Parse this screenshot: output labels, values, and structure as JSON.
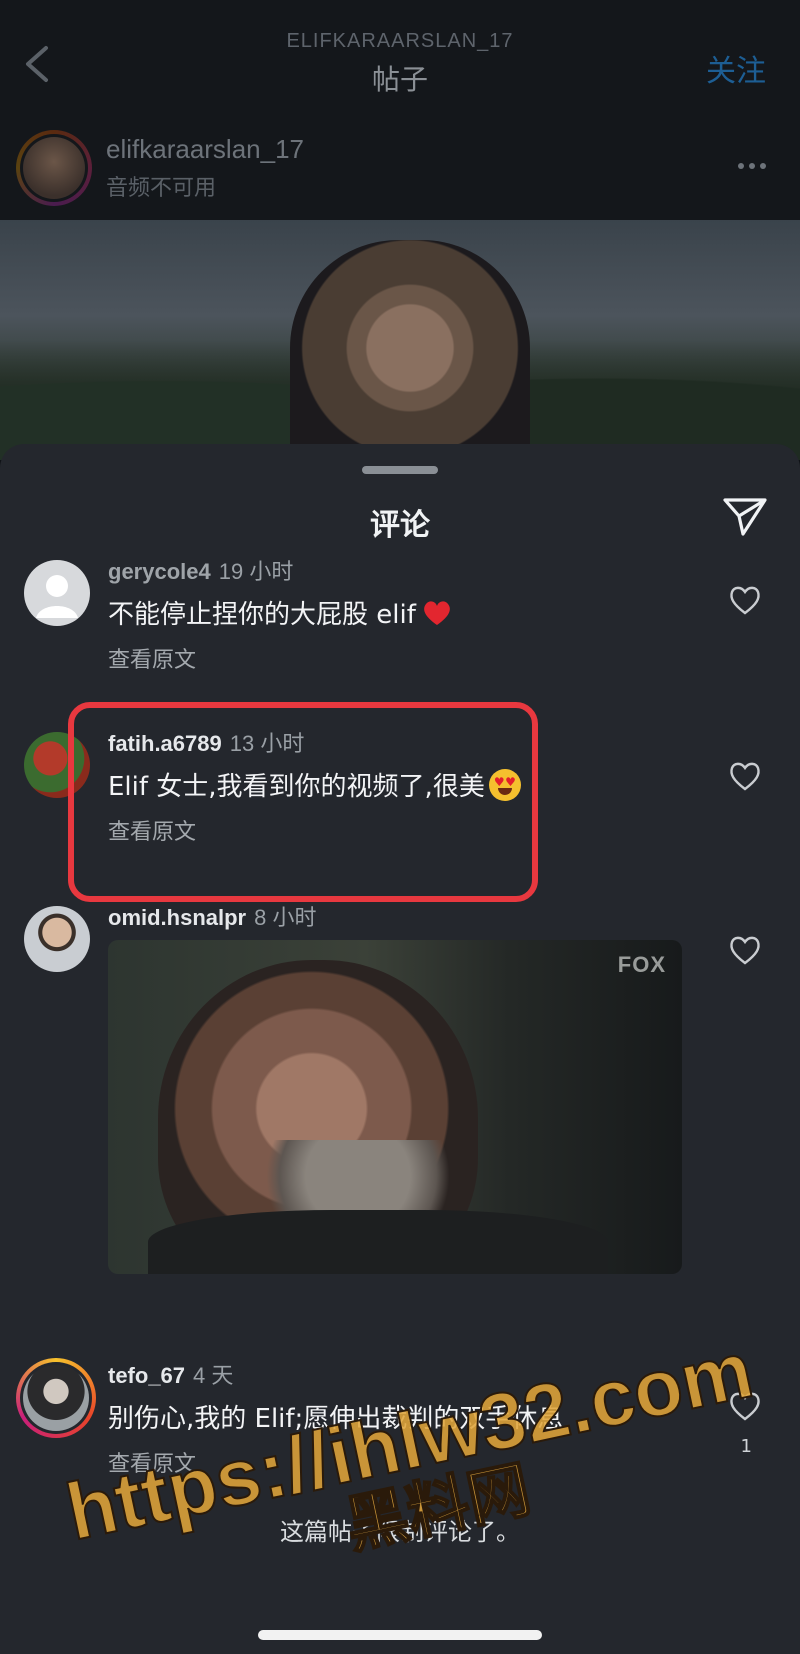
{
  "header": {
    "username": "ELIFKARAARSLAN_17",
    "title": "帖子",
    "follow_label": "关注"
  },
  "post": {
    "author": "elifkaraarslan_17",
    "subtitle": "音频不可用"
  },
  "sheet": {
    "title": "评论",
    "restricted_notice": "这篇帖子限制评论了。"
  },
  "comments": [
    {
      "username": "gerycole4",
      "time": "19 小时",
      "text": "不能停止捏你的大屁股 elif",
      "emoji": "red-heart",
      "translate_label": "查看原文"
    },
    {
      "username": "fatih.a6789",
      "time": "13 小时",
      "text": "Elif 女士,我看到你的视频了,很美",
      "emoji": "heart-eyes-face",
      "translate_label": "查看原文",
      "highlighted": true
    },
    {
      "username": "omid.hsnalpr",
      "time": "8 小时",
      "media": "gif",
      "media_logo": "FOX"
    },
    {
      "username": "tefo_67",
      "time": "4 天",
      "text": "别伤心,我的 Elif;愿伸出裁判的双手休息",
      "translate_label": "查看原文",
      "likes": "1"
    }
  ],
  "watermark": {
    "line1": "https://ihlw32.com",
    "line2": "黑料网"
  },
  "colors": {
    "highlight": "#e8383f",
    "sheet_bg": "#24272d",
    "watermark": "#e0a53a"
  }
}
